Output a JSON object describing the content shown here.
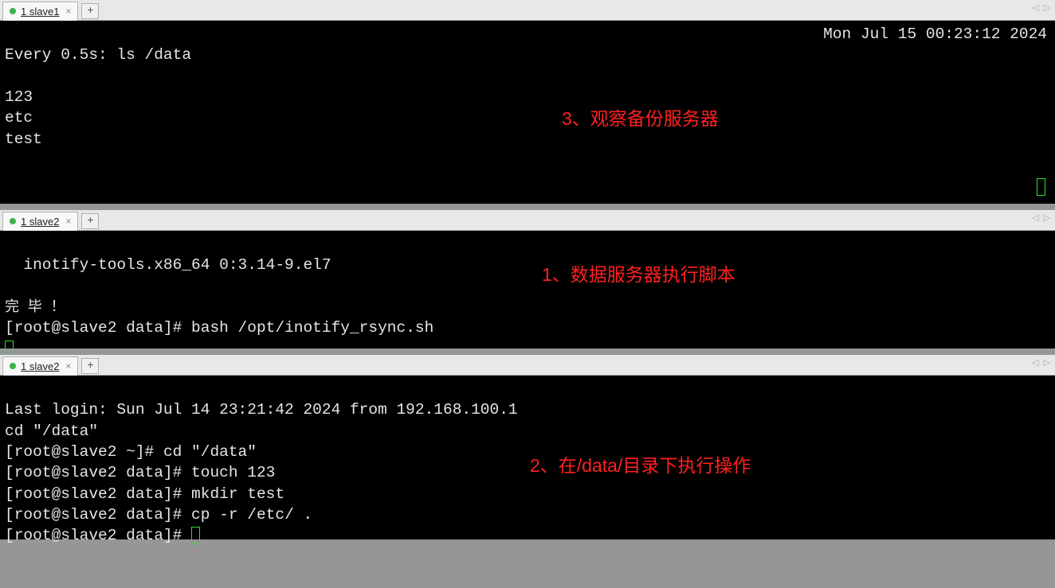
{
  "pane1": {
    "tab_label": "1 slave1",
    "watch_header": "Every 0.5s: ls /data",
    "timestamp": "Mon Jul 15 00:23:12 2024",
    "output_line1": "123",
    "output_line2": "etc",
    "output_line3": "test",
    "annotation": "3、观察备份服务器"
  },
  "pane2": {
    "tab_label": "1 slave2",
    "line1": "  inotify-tools.x86_64 0:3.14-9.el7",
    "line2": "完 毕 ！",
    "prompt": "[root@slave2 data]# ",
    "command": "bash /opt/inotify_rsync.sh",
    "annotation": "1、数据服务器执行脚本"
  },
  "pane3": {
    "tab_label": "1 slave2",
    "login": "Last login: Sun Jul 14 23:21:42 2024 from 192.168.100.1",
    "cd_echo": "cd \"/data\"",
    "p1": "[root@slave2 ~]# ",
    "c1": "cd \"/data\"",
    "p2": "[root@slave2 data]# ",
    "c2": "touch 123",
    "p3": "[root@slave2 data]# ",
    "c3": "mkdir test",
    "p4": "[root@slave2 data]# ",
    "c4": "cp -r /etc/ .",
    "p5": "[root@slave2 data]# ",
    "annotation": "2、在/data/目录下执行操作"
  }
}
